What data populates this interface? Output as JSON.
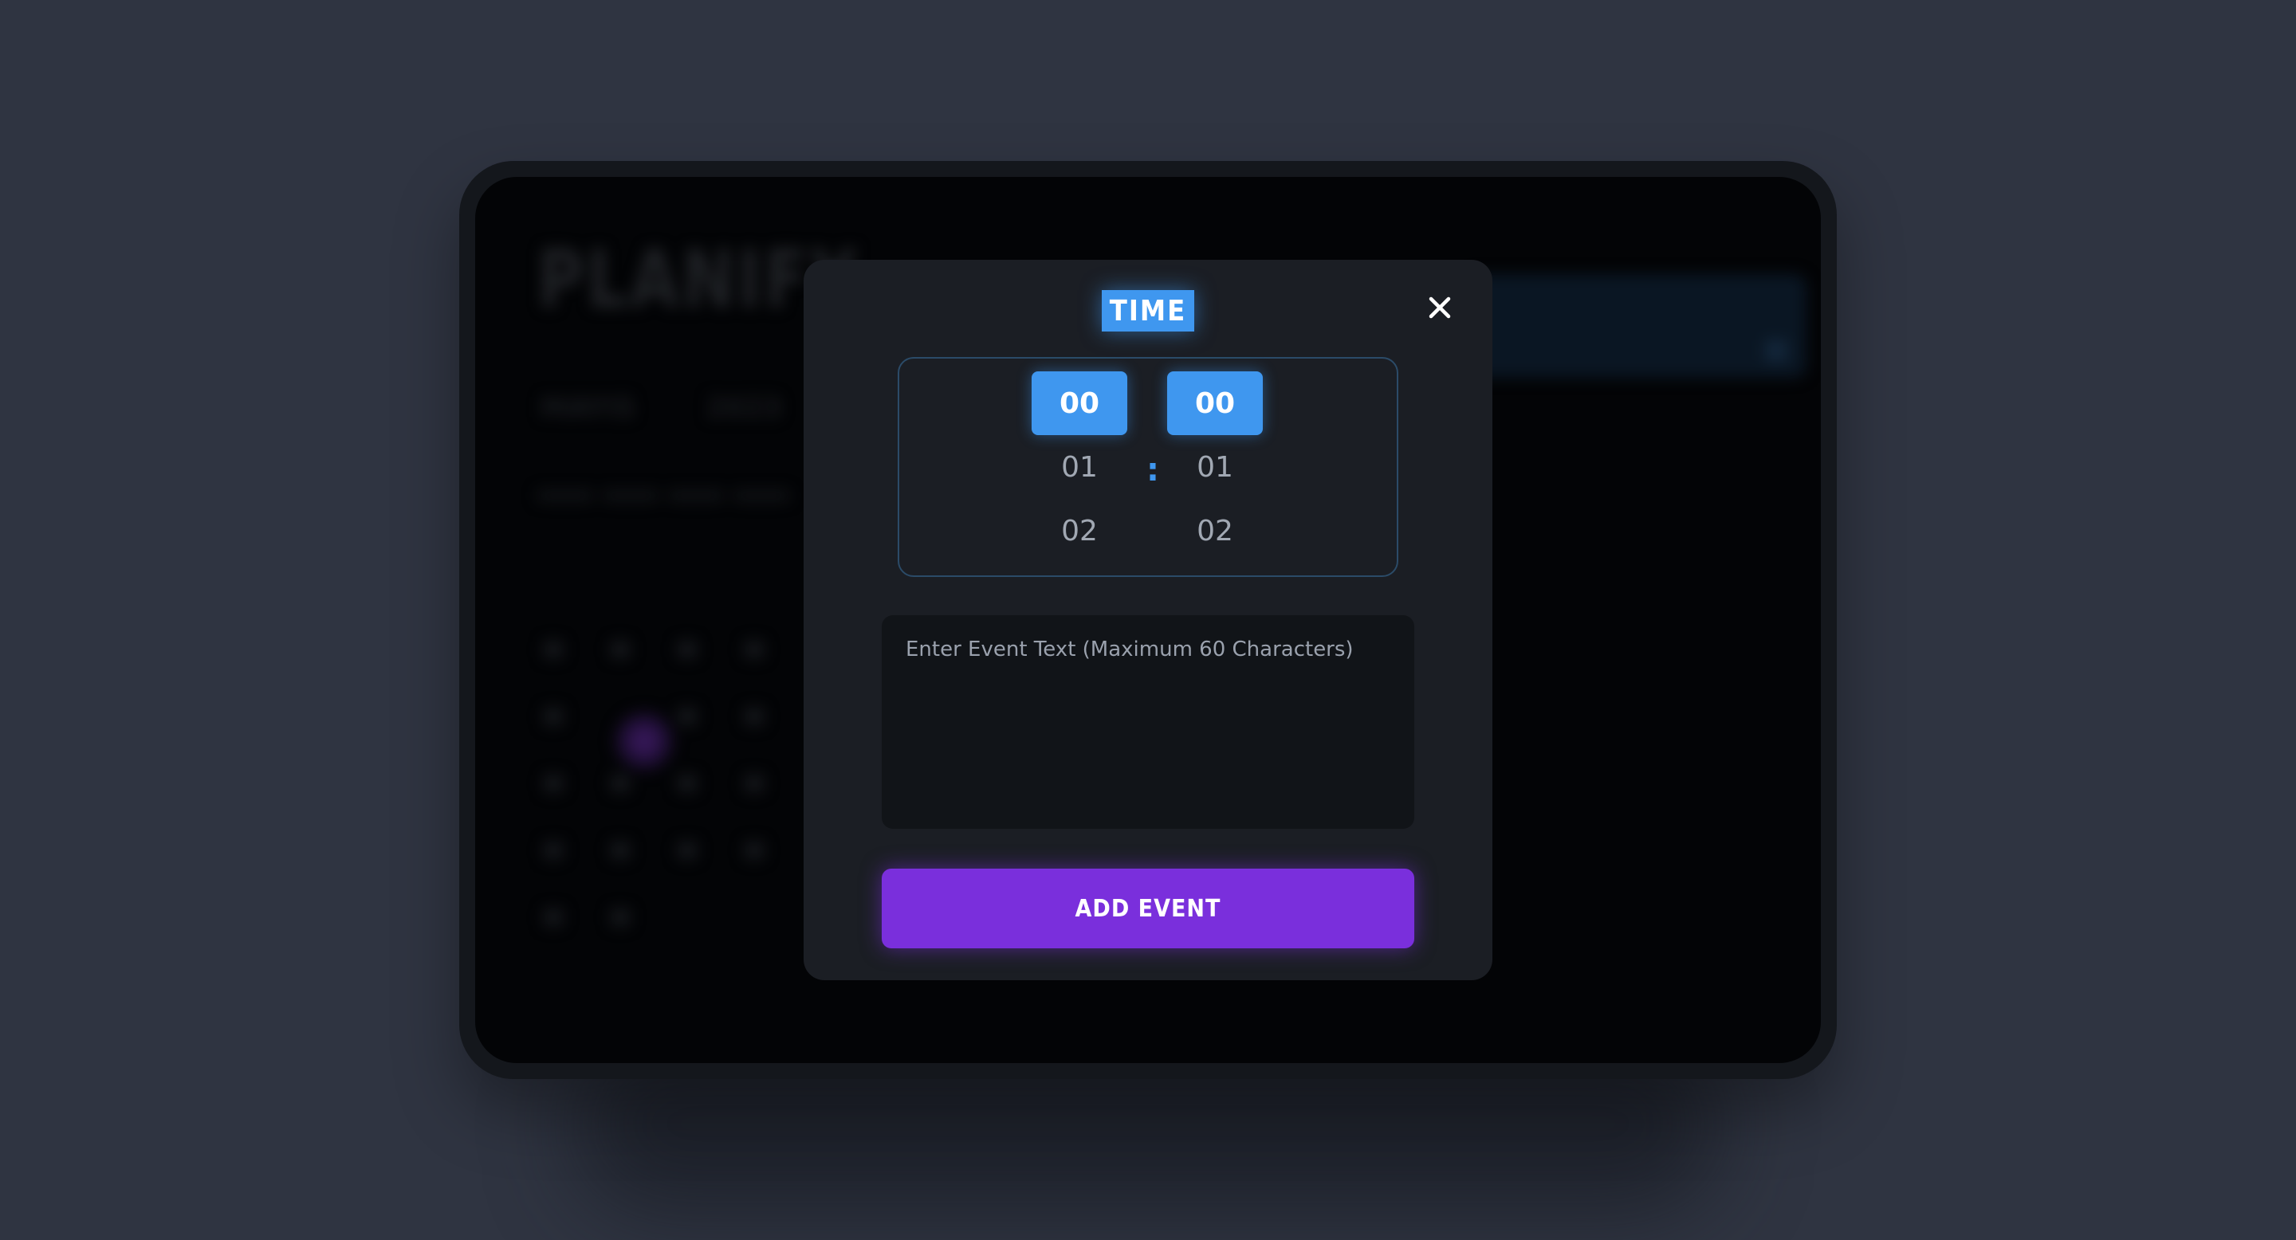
{
  "background_app": {
    "logo": "PLANIFY",
    "month": "MAYIS",
    "year": "2023"
  },
  "modal": {
    "title": "TIME",
    "close_icon": "close-icon",
    "time_picker": {
      "hours": [
        "00",
        "01",
        "02"
      ],
      "minutes": [
        "00",
        "01",
        "02"
      ],
      "selected_hour": "00",
      "selected_minute": "00",
      "separator": ":"
    },
    "event_text_placeholder": "Enter Event Text (Maximum 60 Characters)",
    "add_button_label": "ADD EVENT"
  },
  "colors": {
    "accent_blue": "#3f97ef",
    "accent_purple": "#7a2fdc",
    "modal_bg": "#1b1e24",
    "page_bg": "#2f3441"
  }
}
